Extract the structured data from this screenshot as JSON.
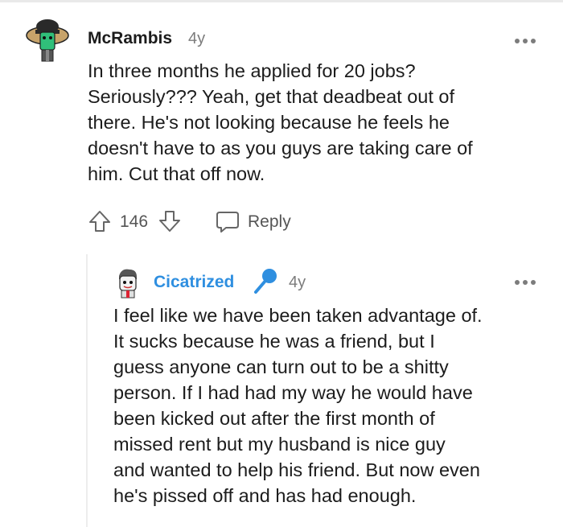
{
  "comment": {
    "author": "McRambis",
    "age": "4y",
    "body_lines": [
      "In three months he applied for 20 jobs?",
      "Seriously??? Yeah, get that deadbeat out of",
      "there. He's not looking because he feels he",
      "doesn't have to as you guys are taking care of",
      "him. Cut that off now."
    ],
    "votes": "146",
    "reply_label": "Reply",
    "icons": {
      "avatar": "avatar-icon",
      "more": "more-options-icon",
      "upvote": "upvote-arrow-icon",
      "downvote": "downvote-arrow-icon",
      "reply": "chat-bubble-icon"
    }
  },
  "reply": {
    "author": "Cicatrized",
    "age": "4y",
    "body_lines": [
      "I feel like we have been taken advantage of.",
      "It sucks because he was a friend, but I",
      "guess anyone can turn out to be a shitty",
      "person. If I had had my way he would have",
      "been kicked out after the first month of",
      "missed rent but my husband is nice guy",
      "and wanted to help his friend. But now even",
      "he's pissed off and has had enough."
    ],
    "author_color": "#2f8fe0",
    "icons": {
      "avatar": "avatar-icon",
      "op_badge": "microphone-icon",
      "more": "more-options-icon"
    }
  }
}
